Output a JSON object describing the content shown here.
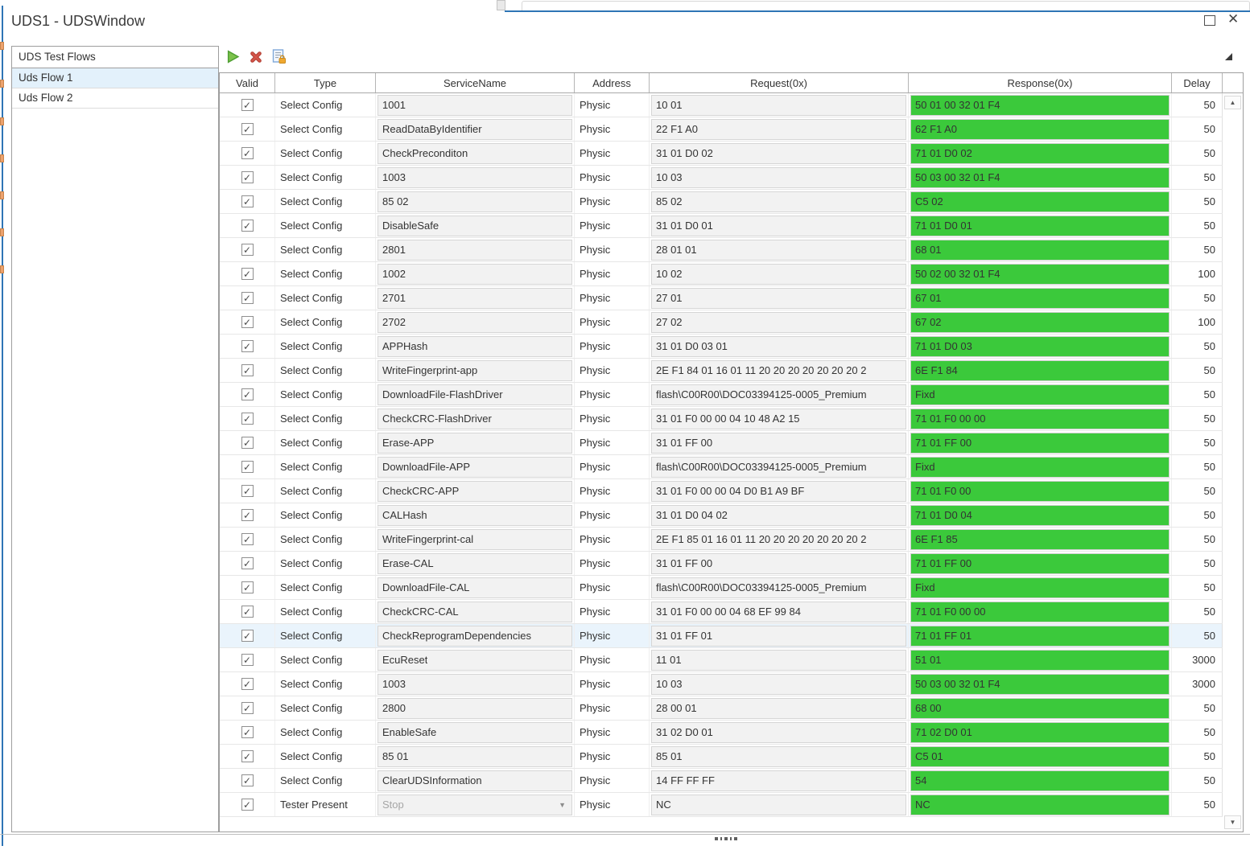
{
  "window": {
    "title": "UDS1 - UDSWindow"
  },
  "icons": {
    "check": "✓",
    "close": "✕",
    "dropdown_arrow": "▼",
    "scroll_up": "▲",
    "scroll_down": "▼",
    "toolbar": [
      "run-icon",
      "delete-icon",
      "save-lock-icon"
    ]
  },
  "colors": {
    "response_green": "#3BC93B",
    "accent_blue": "#2E75B5",
    "selection_blue": "#E3F1FB",
    "row_highlight": "#EAF4FC",
    "input_gray": "#F2F2F2"
  },
  "sidebar": {
    "header": "UDS Test Flows",
    "items": [
      {
        "label": "Uds Flow 1",
        "selected": true
      },
      {
        "label": "Uds Flow 2",
        "selected": false
      }
    ]
  },
  "table": {
    "columns": [
      "Valid",
      "Type",
      "ServiceName",
      "Address",
      "Request(0x)",
      "Response(0x)",
      "Delay"
    ],
    "rows": [
      {
        "valid": true,
        "type": "Select Config",
        "service": "1001",
        "address": "Physic",
        "request": "10 01",
        "response": "50 01 00 32 01 F4",
        "delay": "50"
      },
      {
        "valid": true,
        "type": "Select Config",
        "service": "ReadDataByIdentifier",
        "address": "Physic",
        "request": "22 F1 A0",
        "response": "62 F1 A0",
        "delay": "50"
      },
      {
        "valid": true,
        "type": "Select Config",
        "service": "CheckPreconditon",
        "address": "Physic",
        "request": "31 01 D0 02",
        "response": "71 01 D0 02",
        "delay": "50"
      },
      {
        "valid": true,
        "type": "Select Config",
        "service": "1003",
        "address": "Physic",
        "request": "10 03",
        "response": "50 03 00 32 01 F4",
        "delay": "50"
      },
      {
        "valid": true,
        "type": "Select Config",
        "service": "85 02",
        "address": "Physic",
        "request": "85 02",
        "response": "C5 02",
        "delay": "50"
      },
      {
        "valid": true,
        "type": "Select Config",
        "service": "DisableSafe",
        "address": "Physic",
        "request": "31 01 D0 01",
        "response": "71 01 D0 01",
        "delay": "50"
      },
      {
        "valid": true,
        "type": "Select Config",
        "service": "2801",
        "address": "Physic",
        "request": "28 01 01",
        "response": "68 01",
        "delay": "50"
      },
      {
        "valid": true,
        "type": "Select Config",
        "service": "1002",
        "address": "Physic",
        "request": "10 02",
        "response": "50 02 00 32 01 F4",
        "delay": "100"
      },
      {
        "valid": true,
        "type": "Select Config",
        "service": "2701",
        "address": "Physic",
        "request": "27 01",
        "response": "67 01",
        "delay": "50"
      },
      {
        "valid": true,
        "type": "Select Config",
        "service": "2702",
        "address": "Physic",
        "request": "27 02",
        "response": "67 02",
        "delay": "100"
      },
      {
        "valid": true,
        "type": "Select Config",
        "service": "APPHash",
        "address": "Physic",
        "request": "31 01 D0 03 01",
        "response": "71 01 D0 03",
        "delay": "50"
      },
      {
        "valid": true,
        "type": "Select Config",
        "service": "WriteFingerprint-app",
        "address": "Physic",
        "request": "2E F1 84 01 16 01 11 20 20 20 20 20 20 20 2",
        "response": "6E F1 84",
        "delay": "50"
      },
      {
        "valid": true,
        "type": "Select Config",
        "service": "DownloadFile-FlashDriver",
        "address": "Physic",
        "request": "flash\\C00R00\\DOC03394125-0005_Premium",
        "response": "Fixd",
        "delay": "50"
      },
      {
        "valid": true,
        "type": "Select Config",
        "service": "CheckCRC-FlashDriver",
        "address": "Physic",
        "request": "31 01 F0 00 00 04 10 48 A2 15",
        "response": "71 01 F0 00 00",
        "delay": "50"
      },
      {
        "valid": true,
        "type": "Select Config",
        "service": "Erase-APP",
        "address": "Physic",
        "request": "31 01 FF 00",
        "response": "71 01 FF 00",
        "delay": "50"
      },
      {
        "valid": true,
        "type": "Select Config",
        "service": "DownloadFile-APP",
        "address": "Physic",
        "request": "flash\\C00R00\\DOC03394125-0005_Premium",
        "response": "Fixd",
        "delay": "50"
      },
      {
        "valid": true,
        "type": "Select Config",
        "service": "CheckCRC-APP",
        "address": "Physic",
        "request": "31 01 F0 00 00 04 D0 B1 A9 BF",
        "response": "71 01 F0 00",
        "delay": "50"
      },
      {
        "valid": true,
        "type": "Select Config",
        "service": "CALHash",
        "address": "Physic",
        "request": "31 01 D0 04 02",
        "response": "71 01 D0 04",
        "delay": "50"
      },
      {
        "valid": true,
        "type": "Select Config",
        "service": "WriteFingerprint-cal",
        "address": "Physic",
        "request": "2E F1 85 01 16 01 11 20 20 20 20 20 20 20 2",
        "response": "6E F1 85",
        "delay": "50"
      },
      {
        "valid": true,
        "type": "Select Config",
        "service": "Erase-CAL",
        "address": "Physic",
        "request": "31 01 FF 00",
        "response": "71 01 FF 00",
        "delay": "50"
      },
      {
        "valid": true,
        "type": "Select Config",
        "service": "DownloadFile-CAL",
        "address": "Physic",
        "request": "flash\\C00R00\\DOC03394125-0005_Premium",
        "response": "Fixd",
        "delay": "50"
      },
      {
        "valid": true,
        "type": "Select Config",
        "service": "CheckCRC-CAL",
        "address": "Physic",
        "request": "31 01 F0 00 00 04 68 EF 99 84",
        "response": "71 01 F0 00 00",
        "delay": "50"
      },
      {
        "valid": true,
        "type": "Select Config",
        "service": "CheckReprogramDependencies",
        "address": "Physic",
        "request": "31 01 FF 01",
        "response": "71 01 FF 01",
        "delay": "50",
        "highlighted": true
      },
      {
        "valid": true,
        "type": "Select Config",
        "service": "EcuReset",
        "address": "Physic",
        "request": "11 01",
        "response": "51 01",
        "delay": "3000"
      },
      {
        "valid": true,
        "type": "Select Config",
        "service": "1003",
        "address": "Physic",
        "request": "10 03",
        "response": "50 03 00 32 01 F4",
        "delay": "3000"
      },
      {
        "valid": true,
        "type": "Select Config",
        "service": "2800",
        "address": "Physic",
        "request": "28 00 01",
        "response": "68 00",
        "delay": "50"
      },
      {
        "valid": true,
        "type": "Select Config",
        "service": "EnableSafe",
        "address": "Physic",
        "request": "31 02 D0 01",
        "response": "71 02 D0 01",
        "delay": "50"
      },
      {
        "valid": true,
        "type": "Select Config",
        "service": "85 01",
        "address": "Physic",
        "request": "85 01",
        "response": "C5 01",
        "delay": "50"
      },
      {
        "valid": true,
        "type": "Select Config",
        "service": "ClearUDSInformation",
        "address": "Physic",
        "request": "14 FF FF FF",
        "response": "54",
        "delay": "50"
      },
      {
        "valid": true,
        "type": "Tester Present",
        "service": "Stop",
        "service_dropdown": true,
        "service_placeholder": true,
        "address": "Physic",
        "request": "NC",
        "response": "NC",
        "delay": "50"
      }
    ]
  }
}
